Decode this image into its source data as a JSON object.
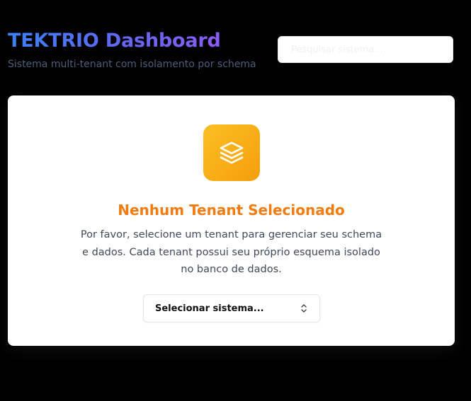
{
  "header": {
    "title": "TEKTRIO Dashboard",
    "subtitle": "Sistema multi-tenant com isolamento por schema",
    "search_placeholder": "Pesquisar sistema..."
  },
  "empty_state": {
    "icon": "layers-icon",
    "title": "Nenhum Tenant Selecionado",
    "description": "Por favor, selecione um tenant para gerenciar seu schema e dados. Cada tenant possui seu próprio esquema isolado no banco de dados.",
    "select_value": "Selecionar sistema...",
    "select_icon": "chevron-up-down-icon"
  },
  "colors": {
    "background": "#000000",
    "title_gradient_start": "#3b82f6",
    "title_gradient_end": "#8b5cf6",
    "accent_orange": "#f07c12",
    "icon_tile": "#fbbf24"
  }
}
